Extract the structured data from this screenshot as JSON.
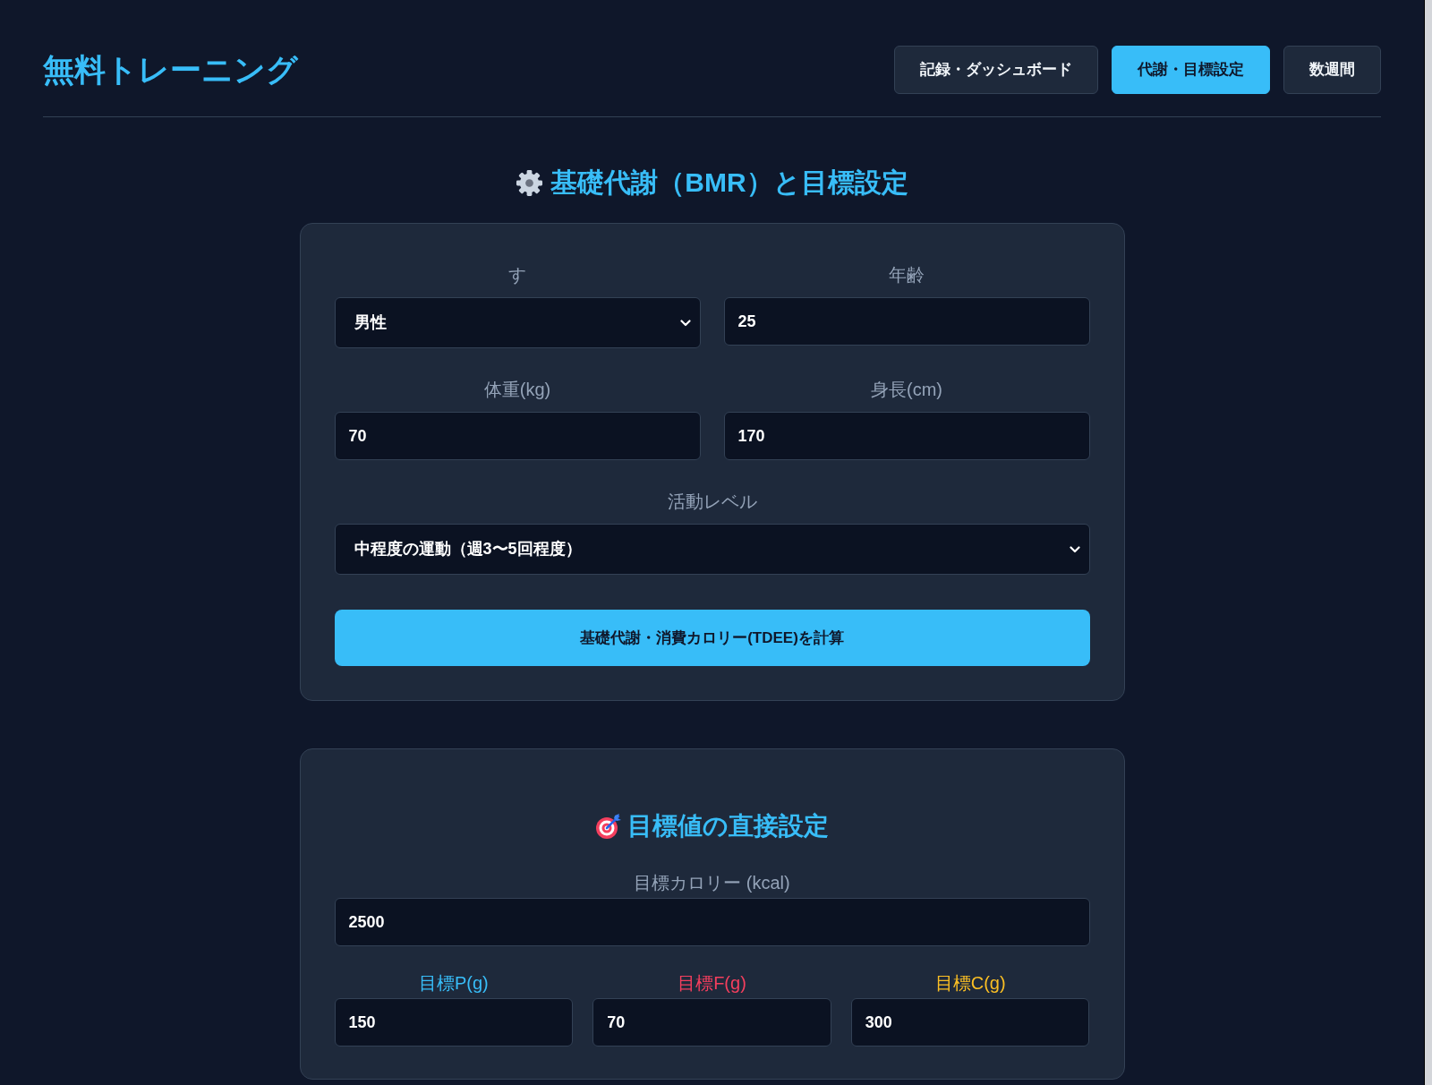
{
  "header": {
    "title": "無料トレーニング",
    "tabs": [
      {
        "label": "記録・ダッシュボード",
        "selected": false
      },
      {
        "label": "代謝・目標設定",
        "selected": true
      },
      {
        "label": "数週間",
        "selected": false
      }
    ]
  },
  "bmr_section": {
    "heading": "基礎代謝（BMR）と目標設定",
    "rows": [
      [
        {
          "kind": "select",
          "label": "す",
          "value": "男性"
        },
        {
          "kind": "input",
          "label": "年齢",
          "value": "25"
        }
      ],
      [
        {
          "kind": "input",
          "label": "体重(kg)",
          "value": "70"
        },
        {
          "kind": "input",
          "label": "身長(cm)",
          "value": "170"
        }
      ],
      [
        {
          "kind": "select",
          "label": "活動レベル",
          "value": "中程度の運動（週3〜5回程度）"
        }
      ]
    ],
    "button": "基礎代謝・消費カロリー(TDEE)を計算"
  },
  "target_section": {
    "heading": "目標値の直接設定",
    "calorie": {
      "label": "目標カロリー (kcal)",
      "value": "2500"
    },
    "macros": [
      {
        "label": "目標P(g)",
        "value": "150",
        "color": "#38bdf8"
      },
      {
        "label": "目標F(g)",
        "value": "70",
        "color": "#f43f5e"
      },
      {
        "label": "目標C(g)",
        "value": "300",
        "color": "#fbbf24"
      }
    ]
  }
}
